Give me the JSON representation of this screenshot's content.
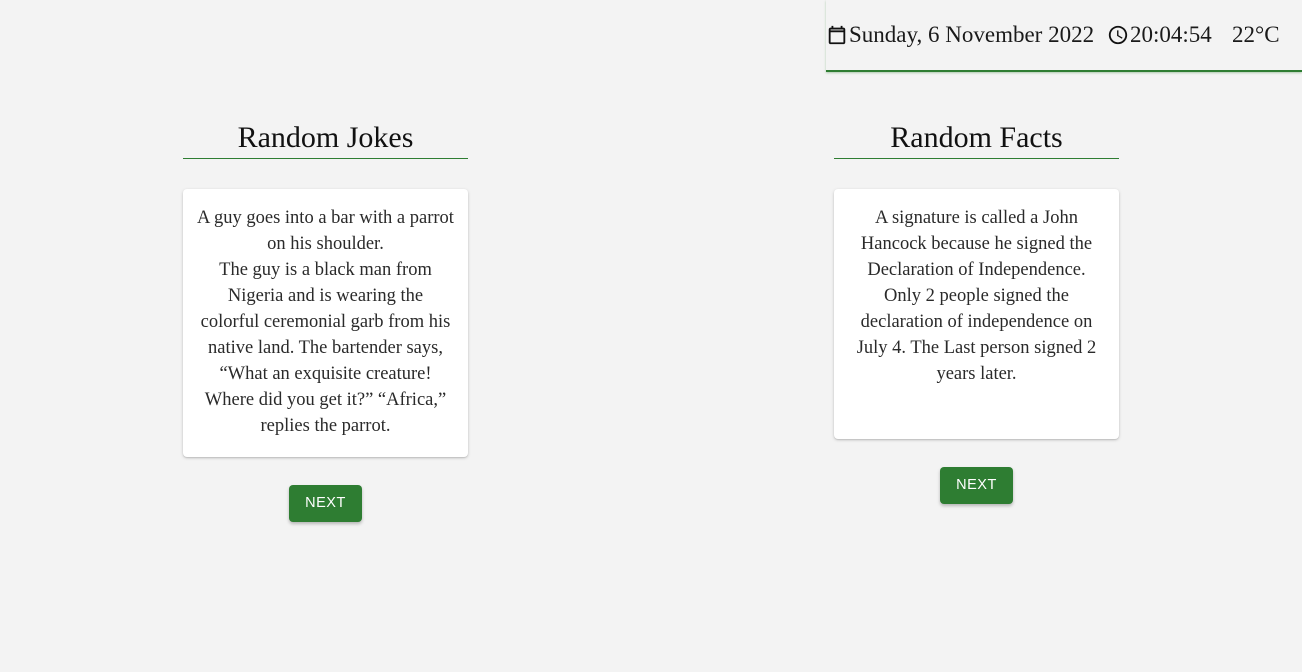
{
  "header": {
    "date": "Sunday, 6 November 2022",
    "time": "20:04:54",
    "temperature": "22°C",
    "accent_color": "#2e7d32",
    "date_icon": "calendar-icon",
    "time_icon": "clock-icon"
  },
  "jokes": {
    "title": "Random Jokes",
    "lines": [
      "A guy goes into a bar with a parrot on his shoulder.",
      "The guy is a black man from Nigeria and is wearing the colorful ceremonial garb from his native land. The bartender says, “What an exquisite creature! Where did you get it?” “Africa,” replies the parrot."
    ],
    "next_label": "NEXT"
  },
  "facts": {
    "title": "Random Facts",
    "text": "A signature is called a John Hancock because he signed the Declaration of Independence. Only 2 people signed the declaration of independence on July 4. The Last person signed 2 years later.",
    "next_label": "NEXT"
  }
}
